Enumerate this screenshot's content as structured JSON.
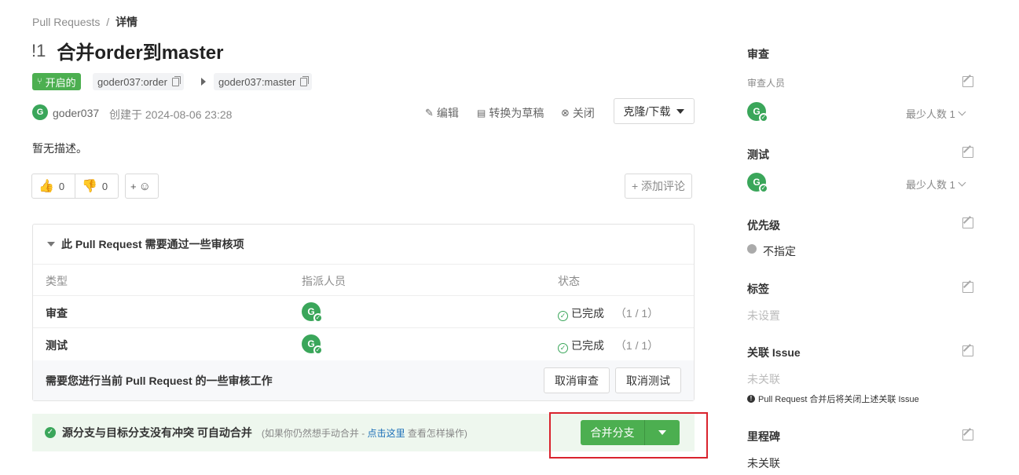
{
  "breadcrumb": {
    "parent": "Pull Requests",
    "separator": "/",
    "current": "详情"
  },
  "pr": {
    "number": "!1",
    "title": "合并order到master",
    "status": "开启的",
    "source_branch": "goder037:order",
    "target_branch": "goder037:master",
    "author_initial": "G",
    "author": "goder037",
    "created": "创建于 2024-08-06 23:28",
    "description": "暂无描述。"
  },
  "toolbar": {
    "edit": "编辑",
    "draft": "转换为草稿",
    "close": "关闭",
    "clone": "克隆/下载"
  },
  "reactions": {
    "thumbs_up_count": "0",
    "thumbs_down_count": "0",
    "add_reaction": "+",
    "add_comment": "+ 添加评论"
  },
  "review_panel": {
    "title": "此 Pull Request 需要通过一些审核项",
    "columns": [
      "类型",
      "指派人员",
      "状态"
    ],
    "rows": [
      {
        "type": "审查",
        "avatar": "G",
        "status": "已完成",
        "count": "（1 / 1）"
      },
      {
        "type": "测试",
        "avatar": "G",
        "status": "已完成",
        "count": "（1 / 1）"
      }
    ],
    "footer_text": "需要您进行当前 Pull Request 的一些审核工作",
    "cancel_review": "取消审查",
    "cancel_test": "取消测试"
  },
  "merge": {
    "message": "源分支与目标分支没有冲突 可自动合并",
    "hint_prefix": "(如果你仍然想手动合并 - ",
    "hint_link": "点击这里",
    "hint_suffix": " 查看怎样操作)",
    "button": "合并分支"
  },
  "sidebar": {
    "review": {
      "title": "审查",
      "sub": "审查人员",
      "avatar": "G",
      "min": "最少人数 1"
    },
    "test": {
      "title": "测试",
      "avatar": "G",
      "min": "最少人数 1"
    },
    "priority": {
      "title": "优先级",
      "value": "不指定"
    },
    "labels": {
      "title": "标签",
      "value": "未设置"
    },
    "issue": {
      "title": "关联 Issue",
      "value": "未关联",
      "note": "Pull Request 合并后将关闭上述关联 Issue"
    },
    "milestone": {
      "title": "里程碑",
      "value": "未关联"
    }
  },
  "colors": {
    "green": "#4caf50",
    "highlight": "#d9232d"
  }
}
